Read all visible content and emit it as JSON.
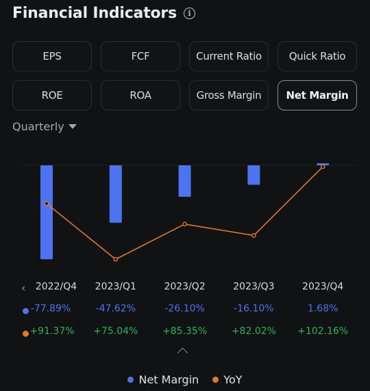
{
  "header": {
    "title": "Financial Indicators",
    "info_icon": "info-icon"
  },
  "tabs": [
    {
      "label": "EPS",
      "active": false
    },
    {
      "label": "FCF",
      "active": false
    },
    {
      "label": "Current Ratio",
      "active": false
    },
    {
      "label": "Quick Ratio",
      "active": false
    },
    {
      "label": "ROE",
      "active": false
    },
    {
      "label": "ROA",
      "active": false
    },
    {
      "label": "Gross Margin",
      "active": false
    },
    {
      "label": "Net Margin",
      "active": true
    }
  ],
  "period": {
    "selected": "Quarterly",
    "icon": "caret-down-icon"
  },
  "colors": {
    "net_margin": "#4d74f0",
    "yoy": "#e0782e",
    "positive": "#2fb35e",
    "background": "#111214"
  },
  "table": {
    "prev_icon": "chevron-left-icon",
    "prev_glyph": "‹",
    "periods": [
      "2022/Q4",
      "2023/Q1",
      "2023/Q2",
      "2023/Q3",
      "2023/Q4"
    ],
    "net_margin_text": [
      "-77.89%",
      "-47.62%",
      "-26.10%",
      "-16.10%",
      "1.68%"
    ],
    "yoy_text": [
      "+91.37%",
      "+75.04%",
      "+85.35%",
      "+82.02%",
      "+102.16%"
    ],
    "expand_icon": "chevron-up-icon"
  },
  "chart_data": {
    "type": "bar",
    "title": "",
    "categories": [
      "2022/Q4",
      "2023/Q1",
      "2023/Q2",
      "2023/Q3",
      "2023/Q4"
    ],
    "series": [
      {
        "name": "Net Margin",
        "type": "bar",
        "unit": "%",
        "values": [
          -77.89,
          -47.62,
          -26.1,
          -16.1,
          1.68
        ]
      },
      {
        "name": "YoY",
        "type": "line",
        "unit": "%",
        "values": [
          91.37,
          75.04,
          85.35,
          82.02,
          102.16
        ]
      }
    ],
    "xlabel": "",
    "ylabel": "",
    "grid": false,
    "legend": "bottom-center"
  },
  "legend": [
    {
      "label": "Net Margin"
    },
    {
      "label": "YoY"
    }
  ]
}
